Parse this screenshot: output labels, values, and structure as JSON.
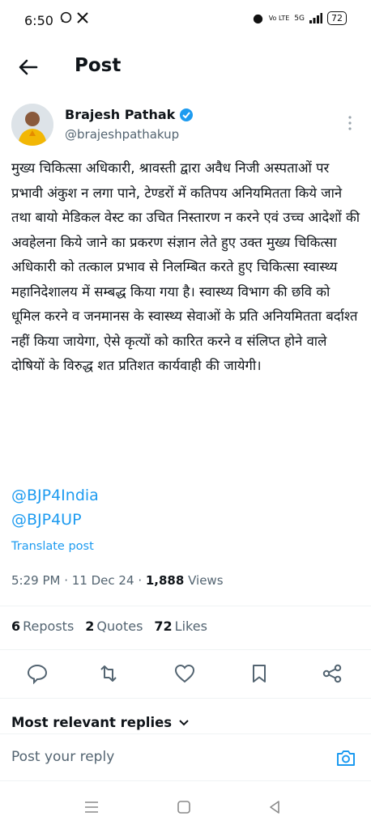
{
  "status_bar": {
    "time": "6:50",
    "network": "Vo LTE",
    "signal": "5G",
    "battery": "72"
  },
  "header": {
    "title": "Post"
  },
  "author": {
    "name": "Brajesh Pathak",
    "handle": "@brajeshpathakup",
    "verified": true
  },
  "post": {
    "text": "मुख्य चिकित्सा अधिकारी, श्रावस्ती द्वारा अवैध निजी अस्पताओं पर प्रभावी अंकुश न लगा पाने, टेण्डरों में कतिपय अनियमितता किये जाने तथा बायो मेडिकल वेस्ट का उचित निस्तारण न करने एवं उच्च आदेशों की अवहेलना किये जाने का प्रकरण  संज्ञान लेते हुए उक्त मुख्य चिकित्सा अधिकारी को तत्काल प्रभाव से निलम्बित करते हुए चिकित्सा स्वास्थ्य महानिदेशालय में सम्बद्ध किया गया है। स्वास्थ्य विभाग की छवि को धूमिल करने व जनमानस के स्वास्थ्य सेवाओं के प्रति अनियमितता बर्दाश्त नहीं किया जायेगा, ऐसे कृत्यों को कारित करने व संलिप्त होने वाले दोषियों के विरुद्ध शत प्रतिशत कार्यवाही की जायेगी।",
    "mentions": [
      "@BJP4India",
      "@BJP4UP"
    ],
    "translate_label": "Translate post",
    "time": "5:29 PM",
    "date": "11 Dec 24",
    "views_count": "1,888",
    "views_label": "Views"
  },
  "stats": {
    "reposts_count": "6",
    "reposts_label": "Reposts",
    "quotes_count": "2",
    "quotes_label": "Quotes",
    "likes_count": "72",
    "likes_label": "Likes"
  },
  "replies": {
    "sort_label": "Most relevant replies",
    "reply_placeholder": "Post your reply"
  },
  "colors": {
    "accent": "#1d9bf0",
    "text": "#0f1419",
    "muted": "#536471"
  }
}
